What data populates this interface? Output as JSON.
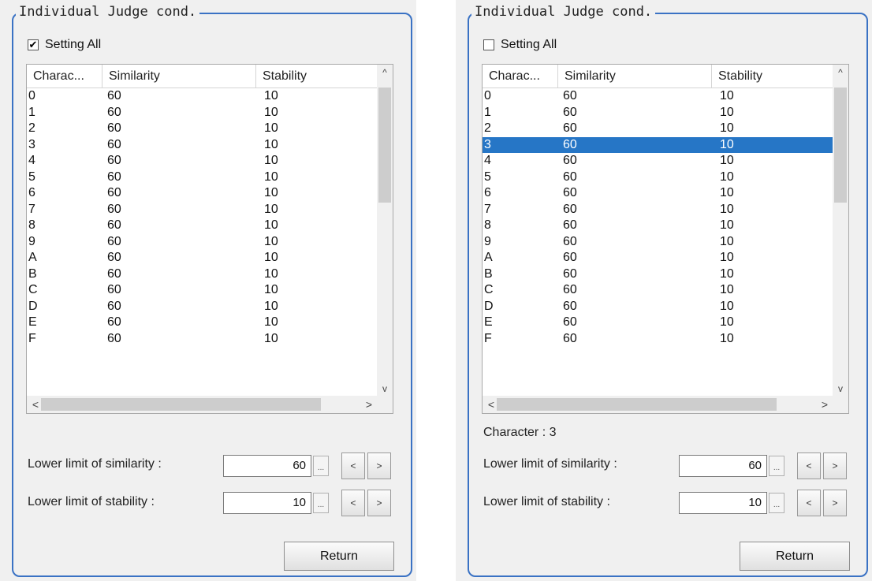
{
  "panels": [
    {
      "title": "Individual Judge cond.",
      "setting_all": {
        "label": "Setting All",
        "checked": true
      },
      "columns": [
        "Charac...",
        "Similarity",
        "Stability"
      ],
      "rows": [
        {
          "char": "0",
          "similarity": "60",
          "stability": "10"
        },
        {
          "char": "1",
          "similarity": "60",
          "stability": "10"
        },
        {
          "char": "2",
          "similarity": "60",
          "stability": "10"
        },
        {
          "char": "3",
          "similarity": "60",
          "stability": "10"
        },
        {
          "char": "4",
          "similarity": "60",
          "stability": "10"
        },
        {
          "char": "5",
          "similarity": "60",
          "stability": "10"
        },
        {
          "char": "6",
          "similarity": "60",
          "stability": "10"
        },
        {
          "char": "7",
          "similarity": "60",
          "stability": "10"
        },
        {
          "char": "8",
          "similarity": "60",
          "stability": "10"
        },
        {
          "char": "9",
          "similarity": "60",
          "stability": "10"
        },
        {
          "char": "A",
          "similarity": "60",
          "stability": "10"
        },
        {
          "char": "B",
          "similarity": "60",
          "stability": "10"
        },
        {
          "char": "C",
          "similarity": "60",
          "stability": "10"
        },
        {
          "char": "D",
          "similarity": "60",
          "stability": "10"
        },
        {
          "char": "E",
          "similarity": "60",
          "stability": "10"
        },
        {
          "char": "F",
          "similarity": "60",
          "stability": "10"
        }
      ],
      "selected_row": null,
      "character_info": "",
      "similarity_label": "Lower limit of similarity :",
      "similarity_value": "60",
      "stability_label": "Lower limit of stability :",
      "stability_value": "10",
      "return_label": "Return"
    },
    {
      "title": "Individual Judge cond.",
      "setting_all": {
        "label": "Setting All",
        "checked": false
      },
      "columns": [
        "Charac...",
        "Similarity",
        "Stability"
      ],
      "rows": [
        {
          "char": "0",
          "similarity": "60",
          "stability": "10"
        },
        {
          "char": "1",
          "similarity": "60",
          "stability": "10"
        },
        {
          "char": "2",
          "similarity": "60",
          "stability": "10"
        },
        {
          "char": "3",
          "similarity": "60",
          "stability": "10"
        },
        {
          "char": "4",
          "similarity": "60",
          "stability": "10"
        },
        {
          "char": "5",
          "similarity": "60",
          "stability": "10"
        },
        {
          "char": "6",
          "similarity": "60",
          "stability": "10"
        },
        {
          "char": "7",
          "similarity": "60",
          "stability": "10"
        },
        {
          "char": "8",
          "similarity": "60",
          "stability": "10"
        },
        {
          "char": "9",
          "similarity": "60",
          "stability": "10"
        },
        {
          "char": "A",
          "similarity": "60",
          "stability": "10"
        },
        {
          "char": "B",
          "similarity": "60",
          "stability": "10"
        },
        {
          "char": "C",
          "similarity": "60",
          "stability": "10"
        },
        {
          "char": "D",
          "similarity": "60",
          "stability": "10"
        },
        {
          "char": "E",
          "similarity": "60",
          "stability": "10"
        },
        {
          "char": "F",
          "similarity": "60",
          "stability": "10"
        }
      ],
      "selected_row": 3,
      "character_info": "Character : 3",
      "similarity_label": "Lower limit of similarity :",
      "similarity_value": "60",
      "stability_label": "Lower limit of stability :",
      "stability_value": "10",
      "return_label": "Return"
    }
  ],
  "glyphs": {
    "check": "✔",
    "scroll_up": "^",
    "scroll_down": "v",
    "scroll_left": "<",
    "scroll_right": ">",
    "ellipsis": "...",
    "prev": "<",
    "next": ">"
  },
  "colors": {
    "accent": "#3a72c4",
    "selection": "#2676c6",
    "panel_bg": "#f0f0f0"
  }
}
